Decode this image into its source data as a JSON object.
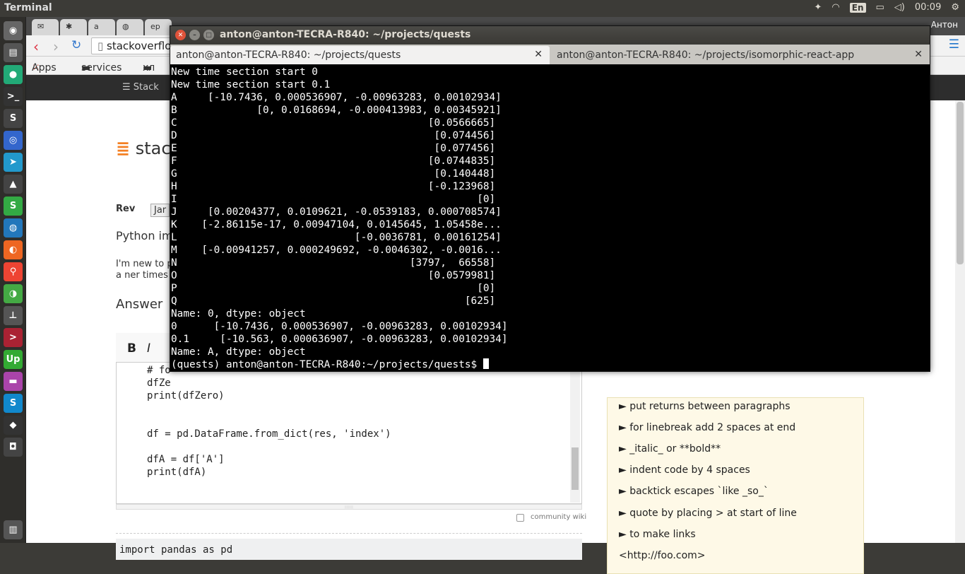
{
  "topbar": {
    "app_name": "Terminal",
    "keyboard": "En",
    "clock": "00:09"
  },
  "browser": {
    "user": "Антон",
    "address": "stackoverflow",
    "bookmarks": [
      "Apps",
      "services",
      "хл"
    ],
    "so_brand": "Stack",
    "logo": "stac",
    "rev_label": "Rev",
    "rev_value": "Jar",
    "question_title": "Python imp",
    "intro_line1": "I'm new to p",
    "intro_line2": "a ner times",
    "answer_heading": "Answer",
    "editor_code": [
      "# fo",
      "dfZe",
      "print(dfZero)",
      "",
      "",
      "df = pd.DataFrame.from_dict(res, 'index')",
      "",
      "dfA = df['A']",
      "print(dfA)"
    ],
    "community_wiki": "community wiki",
    "preview_code": "import pandas as pd",
    "help_items": [
      "► put returns between paragraphs",
      "► for linebreak add 2 spaces at end",
      "► _italic_ or **bold**",
      "► indent code by 4 spaces",
      "► backtick escapes `like _so_`",
      "► quote by placing > at start of line",
      "► to make links",
      "<http://foo.com>"
    ]
  },
  "terminal": {
    "window_title": "anton@anton-TECRA-R840: ~/projects/quests",
    "tabs": [
      {
        "label": "anton@anton-TECRA-R840: ~/projects/quests"
      },
      {
        "label": "anton@anton-TECRA-R840: ~/projects/isomorphic-react-app"
      }
    ],
    "lines": [
      "New time section start 0",
      "New time section start 0.1",
      "A     [-10.7436, 0.000536907, -0.00963283, 0.00102934]",
      "B             [0, 0.0168694, -0.000413983, 0.00345921]",
      "C                                         [0.0566665]",
      "D                                          [0.074456]",
      "E                                          [0.077456]",
      "F                                         [0.0744835]",
      "G                                          [0.140448]",
      "H                                         [-0.123968]",
      "I                                                 [0]",
      "J     [0.00204377, 0.0109621, -0.0539183, 0.000708574]",
      "K    [-2.86115e-17, 0.00947104, 0.0145645, 1.05458e...",
      "L                             [-0.0036781, 0.00161254]",
      "M    [-0.00941257, 0.000249692, -0.0046302, -0.0016...",
      "N                                      [3797,  66558]",
      "O                                         [0.0579981]",
      "P                                                 [0]",
      "Q                                               [625]",
      "Name: 0, dtype: object",
      "0      [-10.7436, 0.000536907, -0.00963283, 0.00102934]",
      "0.1     [-10.563, 0.000636907, -0.00963283, 0.00102934]",
      "Name: A, dtype: object",
      "(quests) anton@anton-TECRA-R840:~/projects/quests$ "
    ]
  }
}
